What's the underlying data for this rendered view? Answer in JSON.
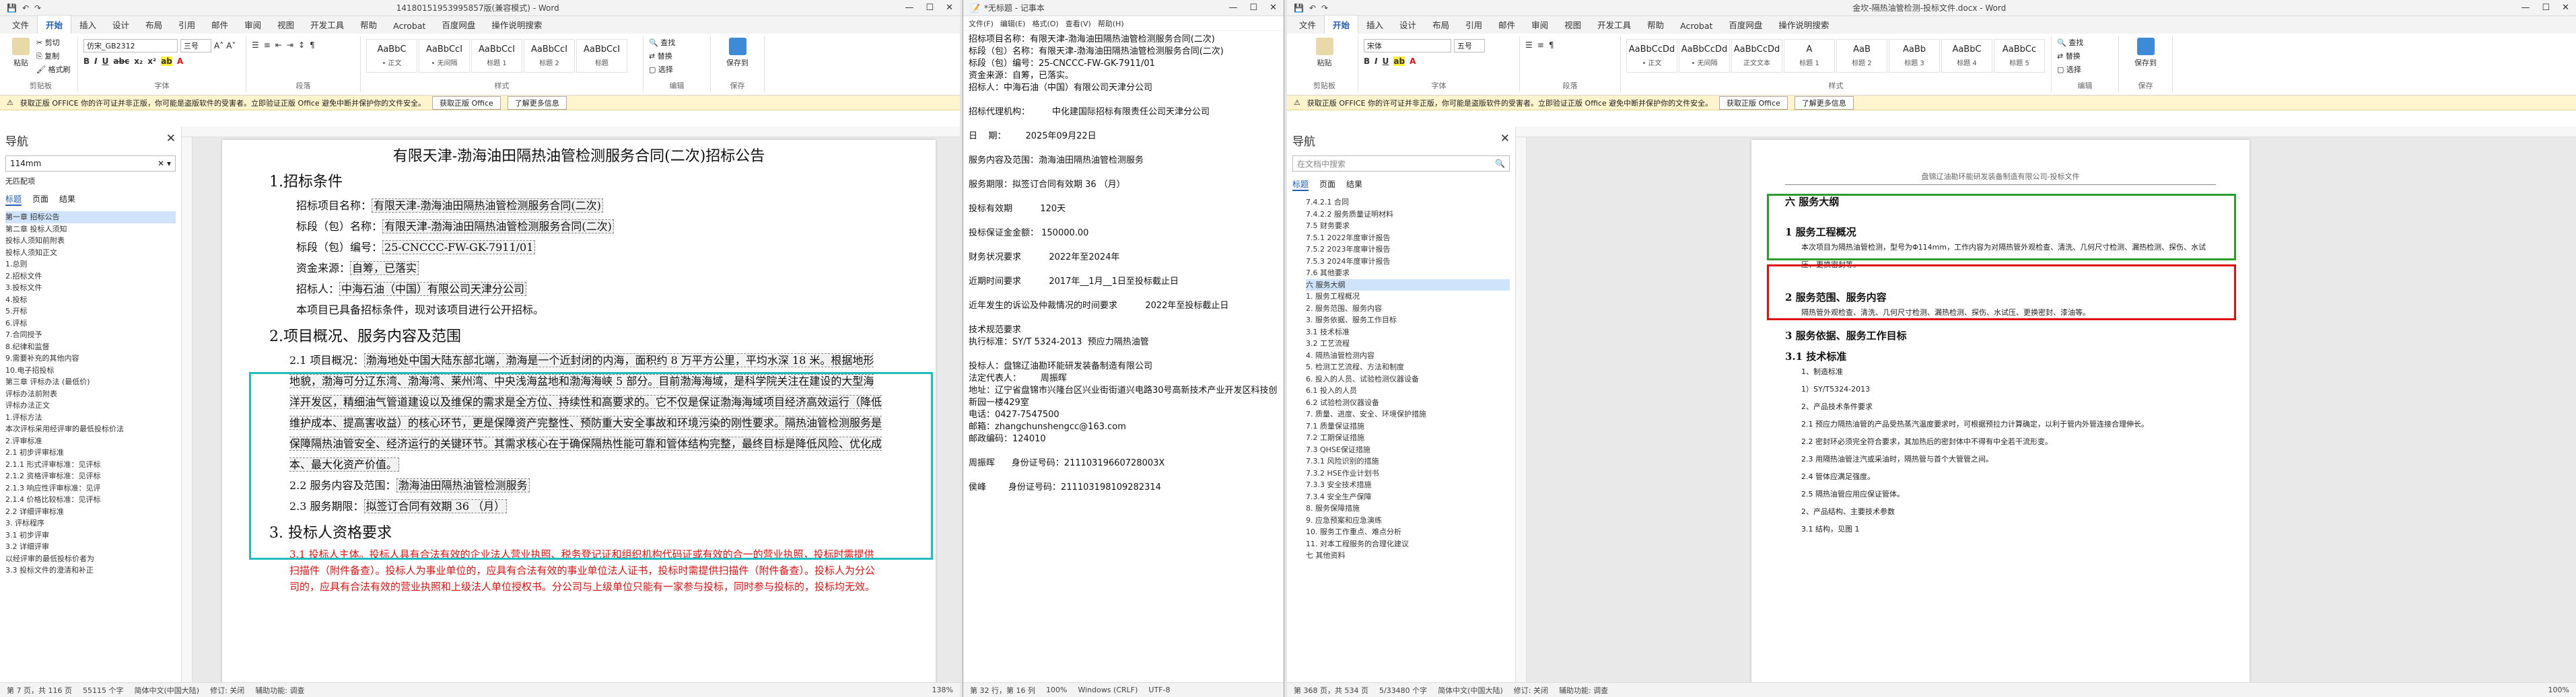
{
  "win1": {
    "title": "14180151953995857版(兼容模式) - Word",
    "tabs": [
      "文件",
      "开始",
      "插入",
      "设计",
      "布局",
      "引用",
      "邮件",
      "审阅",
      "视图",
      "开发工具",
      "帮助",
      "Acrobat",
      "百度网盘",
      "操作说明搜索"
    ],
    "active_tab": "开始",
    "font_name": "仿宋_GB2312",
    "font_size": "三号",
    "styles": [
      {
        "s": "AaBbC",
        "n": "• 正文"
      },
      {
        "s": "AaBbCcI",
        "n": "• 无间隔"
      },
      {
        "s": "AaBbCcI",
        "n": "标题 1"
      },
      {
        "s": "AaBbCcI",
        "n": "标题 2"
      },
      {
        "s": "AaBbCcI",
        "n": "标题"
      }
    ],
    "groups": [
      "剪贴板",
      "字体",
      "段落",
      "样式",
      "编辑",
      "保存"
    ],
    "notice": "获取正版 OFFICE  你的许可证并非正版，你可能是盗版软件的受害者。立即验证正版 Office 避免中断并保护你的文件安全。",
    "notice_btn1": "获取正版 Office",
    "notice_btn2": "了解更多信息",
    "nav_title": "导航",
    "nav_search": "114mm",
    "nav_noresult": "无匹配项",
    "nav_tabs": [
      "标题",
      "页面",
      "结果"
    ],
    "nav_items": [
      "第一章 招标公告",
      "第二章 投标人须知",
      "投标人须知前附表",
      "投标人须知正文",
      "1.总则",
      "2.招标文件",
      "3.投标文件",
      "4.投标",
      "5.开标",
      "6.评标",
      "7.合同授予",
      "8.纪律和监督",
      "9.需要补充的其他内容",
      "10.电子招投标",
      "第三章 评标办法 (最低价)",
      "评标办法前附表",
      "评标办法正文",
      "1.评标方法",
      "本次评标采用经评审的最低投标价法",
      "2.评审标准",
      "2.1 初步评审标准",
      "2.1.1 形式评审标准：见评标",
      "2.1.2 资格评审标准：见评标",
      "2.1.3 响应性评审标准：见评",
      "2.1.4 价格比较标准：见评标",
      "2.2 详细评审标准",
      "3. 评标程序",
      "3.1 初步评审",
      "3.2 详细评审",
      "以经评审的最低投标价者为",
      "3.3 投标文件的澄清和补正"
    ],
    "nav_highlight": 0,
    "doc_title": "有限天津-渤海油田隔热油管检测服务合同(二次)招标公告",
    "h1": "1.招标条件",
    "fields": [
      {
        "label": "招标项目名称：",
        "value": "有限天津-渤海油田隔热油管检测服务合同(二次)"
      },
      {
        "label": "标段（包）名称：",
        "value": "有限天津-渤海油田隔热油管检测服务合同(二次)"
      },
      {
        "label": "标段（包）编号：",
        "value": "25-CNCCC-FW-GK-7911/01"
      },
      {
        "label": "资金来源：",
        "value": "自筹，已落实"
      },
      {
        "label": "招标人：",
        "value": "中海石油（中国）有限公司天津分公司"
      }
    ],
    "cond_line": "本项目已具备招标条件，现对该项目进行公开招标。",
    "h2": "2.项目概况、服务内容及范围",
    "overview_label": "2.1 项目概况：",
    "overview": "渤海地处中国大陆东部北端，渤海是一个近封闭的内海，面积约 8 万平方公里，平均水深 18 米。根据地形地貌，渤海可分辽东湾、渤海湾、莱州湾、中央浅海盆地和渤海海峡 5 部分。目前渤海海域，是科学院关注在建设的大型海洋开发区，精细油气管道建设以及维保的需求是全方位、持续性和高要求的。它不仅是保证渤海海域项目经济高效运行（降低维护成本、提高害收益）的核心环节，更是保障资产完整性、预防重大安全事故和环境污染的刚性要求。隔热油管检测服务是保障隔热油管安全、经济运行的关键环节。其需求核心在于确保隔热性能可靠和管体结构完整，最终目标是降低风险、优化成本、最大化资产价值。",
    "scope_label": "2.2 服务内容及范围：",
    "scope_value": "渤海油田隔热油管检测服务",
    "period_label": "2.3 服务期限：",
    "period_value": "拟签订合同有效期 36 （月）",
    "h3": "3. 投标人资格要求",
    "red_para": "3.1 投标人主体。投标人具有合法有效的企业法人营业执照、税务登记证和组织机构代码证或有效的合一的营业执照，投标时需提供扫描件（附件备查）。投标人为事业单位的，应具有合法有效的事业单位法人证书，投标时需提供扫描件（附件备查）。投标人为分公司的，应具有合法有效的营业执照和上级法人单位授权书。分公司与上级单位只能有一家参与投标，同时参与投标的，投标均无效。",
    "status": [
      "第 7 页，共 116 页",
      "55115 个字",
      "简体中文(中国大陆)",
      "修订: 关闭",
      "辅助功能: 调查"
    ],
    "zoom": "138%"
  },
  "win2": {
    "title": "*无标题 - 记事本",
    "menu": [
      "文件(F)",
      "编辑(E)",
      "格式(O)",
      "查看(V)",
      "帮助(H)"
    ],
    "lines": [
      "招标项目名称：有限天津-渤海油田隔热油管检测服务合同(二次)",
      "标段（包）名称：有限天津-渤海油田隔热油管检测服务合同(二次)",
      "标段（包）编号：25-CNCCC-FW-GK-7911/01",
      "资金来源：自筹，已落实。",
      "招标人：中海石油（中国）有限公司天津分公司",
      "",
      "招标代理机构：        中化建国际招标有限责任公司天津分公司",
      "",
      "日    期：       2025年09月22日",
      "",
      "服务内容及范围：渤海油田隔热油管检测服务",
      "",
      "服务期限：拟签订合同有效期 36 （月）",
      "",
      "投标有效期          120天",
      "",
      "投标保证金金额： 150000.00",
      "",
      "财务状况要求          2022年至2024年",
      "",
      "近期时间要求          2017年__1月__1日至投标截止日",
      "",
      "近年发生的诉讼及仲裁情况的时间要求          2022年至投标截止日",
      "",
      "技术规范要求",
      "执行标准：SY/T 5324-2013  预应力隔热油管",
      "",
      "投标人：盘锦辽油勘环能研发装备制造有限公司",
      "法定代表人：       周振晖",
      "地址：辽宁省盘锦市兴隆台区兴业街街道兴电路30号高新技术产业开发区科技创新园一楼429室",
      "电话：0427-7547500",
      "邮箱：zhangchunshengcc@163.com",
      "邮政编码：124010",
      "",
      "周振晖      身份证号码：21110319660728003X",
      "",
      "侯峰        身份证号码：211103198109282314"
    ],
    "status": [
      "第 32 行，第 16 列",
      "100%",
      "Windows (CRLF)",
      "UTF-8"
    ]
  },
  "win3": {
    "title": "金坎-隔热油管检测-投标文件.docx - Word",
    "tabs": [
      "文件",
      "开始",
      "插入",
      "设计",
      "布局",
      "引用",
      "邮件",
      "审阅",
      "视图",
      "开发工具",
      "帮助",
      "Acrobat",
      "百度网盘",
      "操作说明搜索"
    ],
    "active_tab": "开始",
    "font_name": "宋体",
    "font_size": "五号",
    "styles": [
      {
        "s": "AaBbCcDd",
        "n": "• 正文"
      },
      {
        "s": "AaBbCcDd",
        "n": "• 无间隔"
      },
      {
        "s": "AaBbCcDd",
        "n": "正文文本"
      },
      {
        "s": "A",
        "n": "标题 1"
      },
      {
        "s": "AaB",
        "n": "标题 2"
      },
      {
        "s": "AaBb",
        "n": "标题 3"
      },
      {
        "s": "AaBbC",
        "n": "标题 4"
      },
      {
        "s": "AaBbCc",
        "n": "标题 5"
      }
    ],
    "notice": "获取正版 OFFICE  你的许可证并非正版，你可能是盗版软件的受害者。立即验证正版 Office 避免中断并保护你的文件安全。",
    "nav_title": "导航",
    "nav_search": "在文档中搜索",
    "nav_items": [
      "7.4.2.1 合同",
      "7.4.2.2 服务质量证明材料",
      "7.5 财务要求",
      "7.5.1 2022年度审计报告",
      "7.5.2 2023年度审计报告",
      "7.5.3 2024年度审计报告",
      "7.6 其他要求",
      "六 服务大纲",
      "1. 服务工程概况",
      "2. 服务范围、服务内容",
      "3. 服务依据、服务工作目标",
      "3.1 技术标准",
      "3.2 工艺流程",
      "4. 隔热油管检测内容",
      "5. 检测工艺流程、方法和制度",
      "6. 投入的人员、试验检测仪器设备",
      "6.1 投入的人员",
      "6.2 试验检测仪器设备",
      "7. 质量、进度、安全、环境保护措施",
      "7.1 质量保证措施",
      "7.2 工期保证措施",
      "7.3 QHSE保证措施",
      "7.3.1 风险识别的措施",
      "7.3.2 HSE作业计划书",
      "7.3.3 安全技术措施",
      "7.3.4 安全生产保障",
      "8. 服务保障措施",
      "9. 应急预案和应急演练",
      "10. 服务工作重点、难点分析",
      "11. 对本工程服务的合理化建议",
      "七 其他资料"
    ],
    "nav_highlight": 7,
    "doc_header": "盘锦辽油勘环能研发装备制造有限公司-投标文件",
    "sec_title": "六 服务大纲",
    "h1": "1 服务工程概况",
    "p1": "本次项目为隔热油管检测，型号为Φ114mm，工作内容为对隔热管外观检查、清洗、几何尺寸检测、漏热检测、探伤、水试压、更换密封等。",
    "h2": "2 服务范围、服务内容",
    "p2": "隔热管外观检查、清洗、几何尺寸检测、漏热检测、探伤、水试压、更换密封、漆油等。",
    "h3": "3 服务依据、服务工作目标",
    "h31": "3.1 技术标准",
    "body": [
      "1、制造标准",
      "1）SY/T5324-2013",
      "2、产品技术条件要求",
      "2.1 预应力隔热油管的产品受热蒸汽温度要求时，可根据预拉力计算确定，以利于管内外管连接合理伸长。",
      "2.2 密封环必须完全符合要求，其加热后的密封体中不得有中全若干流形变。",
      "2.3 用隔热油管注汽或采油时，隔热管与首个大管管之间。",
      "2.4 管体应满足强度。",
      "2.5 隔热油管应用应保证管体。",
      "2、产品结构、主要技术参数",
      "3.1 结构，见图 1"
    ],
    "status": [
      "第 368 页，共 534 页",
      "5/33480 个字",
      "简体中文(中国大陆)",
      "修订: 关闭",
      "辅助功能: 调查"
    ],
    "zoom": "100%"
  }
}
